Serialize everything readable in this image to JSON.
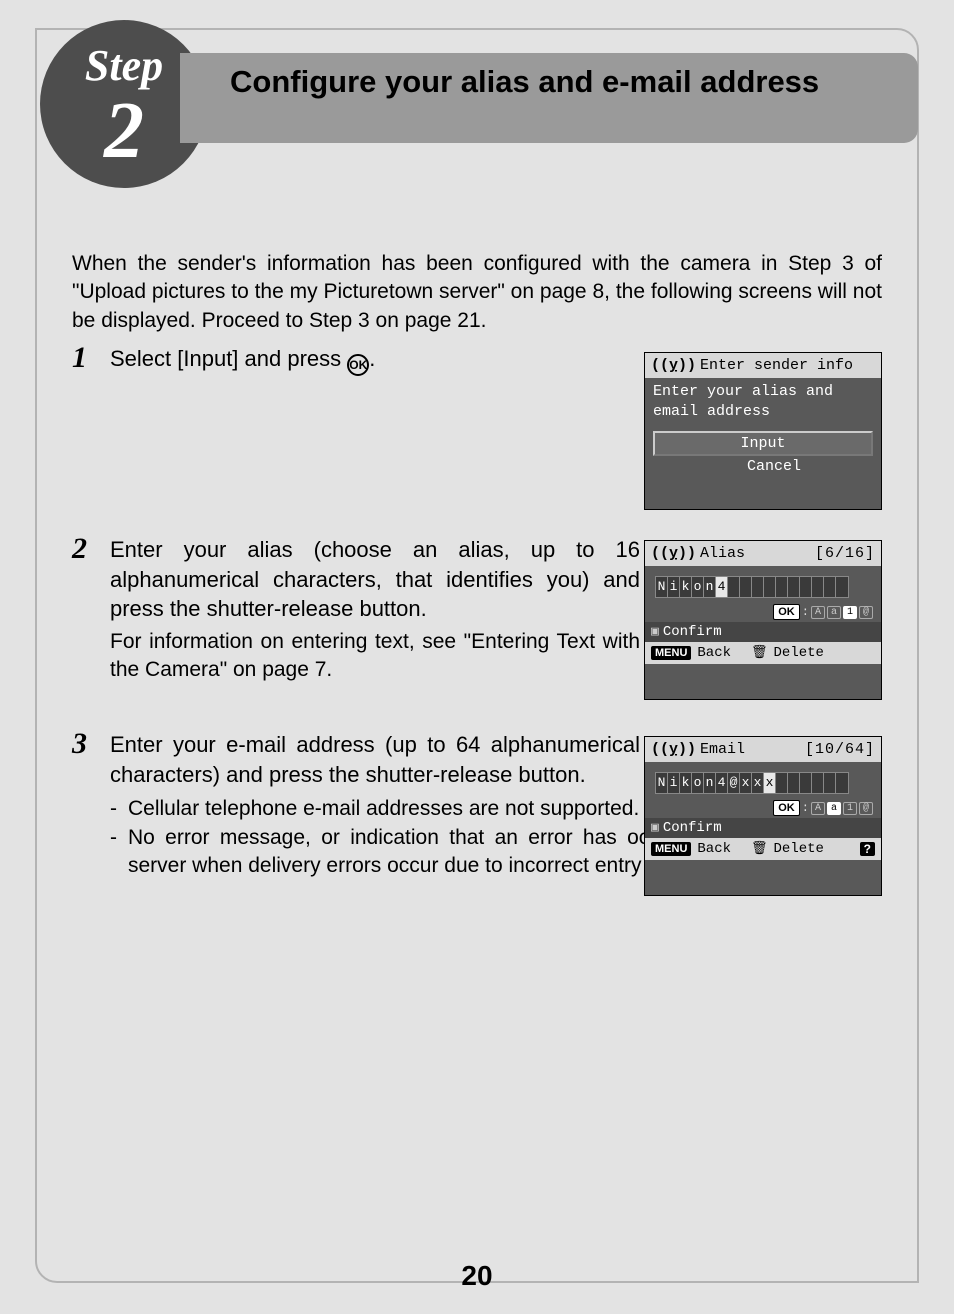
{
  "step_badge": {
    "word": "Step",
    "number": "2"
  },
  "title": "Configure your alias and e-mail address",
  "intro": "When the sender's information has been configured with the camera in Step 3 of \"Upload pictures to the my Picturetown server\" on page 8, the following screens will not be displayed. Proceed to Step 3 on page 21.",
  "steps": {
    "s1": {
      "num": "1",
      "text_before": "Select [Input] and press ",
      "text_after": "."
    },
    "s2": {
      "num": "2",
      "main": "Enter your alias (choose an alias, up to 16 alphanumerical characters, that identifies you) and press the shutter-release button.",
      "sub": "For information on entering text, see \"Entering Text with the Camera\" on page 7."
    },
    "s3": {
      "num": "3",
      "main": "Enter your e-mail address (up to 64 alphanumerical characters) and press the shutter-release button.",
      "bullets": [
        "Cellular telephone e-mail addresses are not supported.",
        "No error message, or indication that an error has occurred, is sent from the server when delivery errors occur due to incorrect entry of e-mail addresses."
      ]
    }
  },
  "lcd1": {
    "header": "Enter sender info",
    "msg1": "Enter your alias and",
    "msg2": "email address",
    "btn_input": "Input",
    "btn_cancel": "Cancel"
  },
  "lcd2": {
    "header": "Alias",
    "counter": "[6/16]",
    "chars": [
      "N",
      "i",
      "k",
      "o",
      "n",
      "4",
      "",
      "",
      "",
      "",
      "",
      "",
      "",
      "",
      "",
      ""
    ],
    "cursor_index": 5,
    "ok_label": "OK",
    "confirm": "Confirm",
    "menu_label": "MENU",
    "back": "Back",
    "delete": "Delete"
  },
  "lcd3": {
    "header": "Email",
    "counter": "[10/64]",
    "chars": [
      "N",
      "i",
      "k",
      "o",
      "n",
      "4",
      "@",
      "x",
      "x",
      "x",
      "",
      "",
      "",
      "",
      "",
      ""
    ],
    "cursor_index": 9,
    "ok_label": "OK",
    "confirm": "Confirm",
    "menu_label": "MENU",
    "back": "Back",
    "delete": "Delete",
    "help": "?"
  },
  "ok_glyph": "OK",
  "page_number": "20"
}
